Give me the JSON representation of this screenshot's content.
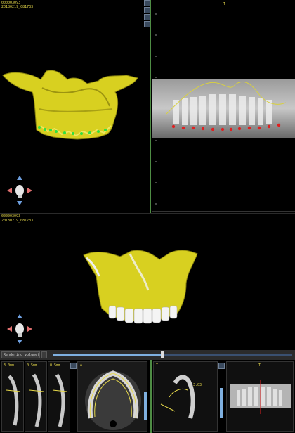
{
  "top_viewport": {
    "case_id": "000003093",
    "timestamp": "20180219_081733"
  },
  "bottom_viewport": {
    "case_id": "000003093",
    "timestamp": "20180219_081733"
  },
  "panorama_panel": {
    "label": "T"
  },
  "control_bar": {
    "render_dropdown": "Rendering volumetrico",
    "slider_value": 0.45
  },
  "bottom_panels": {
    "slice_labels": [
      "3.0mm",
      "0.5mm",
      "0.5mm"
    ],
    "axial_label": "A",
    "sagittal_label": "T",
    "sagittal_length": "3.03",
    "pano_label": "T"
  },
  "colors": {
    "overlay_text": "#e6d84a",
    "bone": "#e8e030",
    "panel_divider": "#4e8c44",
    "nerve_marker": "#e02020",
    "tooth_marker": "#30e040",
    "slider_track": "#7fb0e0"
  },
  "icons": [
    "orientation-head-icon",
    "arrow-up-icon",
    "arrow-down-icon",
    "arrow-left-icon",
    "arrow-right-icon",
    "toolbar-icon"
  ]
}
